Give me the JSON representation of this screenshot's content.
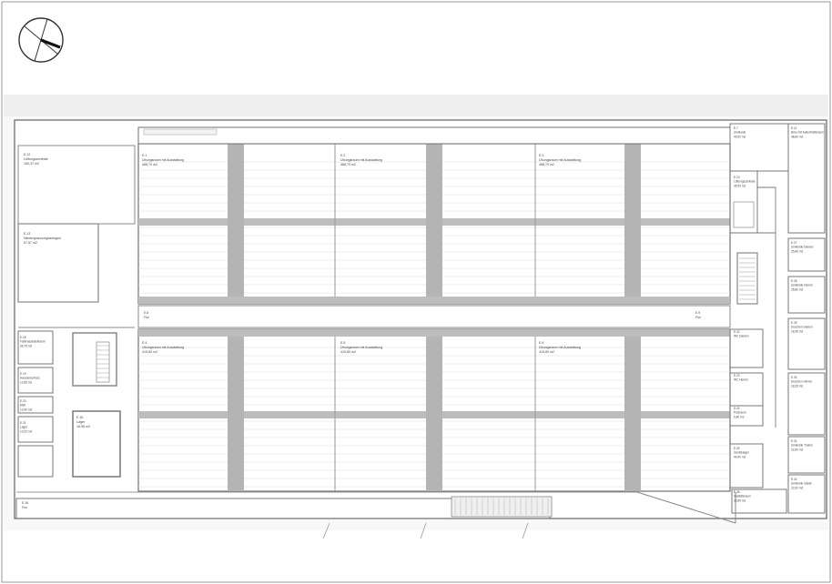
{
  "drawing": {
    "colors": {
      "line": "#6f6f6f",
      "column": "#b4b4b4",
      "beam": "#bdbdbd",
      "hatch": "#d9d9d9",
      "band": "#ededed",
      "text": "#555555"
    },
    "compass": {
      "icon": "north-arrow-icon"
    },
    "rooms": {
      "r1": {
        "id": "E.12",
        "name": "Lüftungszentrale",
        "area": "150,37 m2"
      },
      "r2": {
        "id": "E.13",
        "name": "Niederspannungsanlagen",
        "area": "57,57 m2"
      },
      "r3": {
        "id": "E.15",
        "name": "Lager",
        "area": "16,98 m2"
      },
      "rooms_left": [
        {
          "id": "E.18",
          "name": "Fahrradabstellraum",
          "area": "36,75 m2"
        },
        {
          "id": "E.19",
          "name": "Hausanschluss",
          "area": "12,85 m2"
        },
        {
          "id": "E.20",
          "name": "Müll",
          "area": "13,40 m2"
        },
        {
          "id": "E.21",
          "name": "Lager",
          "area": "10,20 m2"
        }
      ],
      "hall_top": [
        {
          "id": "E.1",
          "name": "Übungsraum mit Ausstattung",
          "area": "488,70 m2"
        },
        {
          "id": "E.2",
          "name": "Übungsraum mit Ausstattung",
          "area": "488,70 m2"
        },
        {
          "id": "E.3",
          "name": "Übungsraum mit Ausstattung",
          "area": "488,70 m2"
        }
      ],
      "hall_bottom": [
        {
          "id": "E.4",
          "name": "Übungsraum mit Ausstattung",
          "area": "415,80 m2"
        },
        {
          "id": "E.5",
          "name": "Übungsraum mit Ausstattung",
          "area": "415,80 m2"
        },
        {
          "id": "E.6",
          "name": "Übungsraum mit Ausstattung",
          "area": "415,80 m2"
        }
      ],
      "corridor_left": {
        "id": "E.8",
        "name": "Flur"
      },
      "corridor_right": {
        "id": "E.9",
        "name": "Flur"
      },
      "right_col": [
        {
          "id": "E.7",
          "name": "Umkleide",
          "area": "45,50 m2"
        },
        {
          "id": "E.10",
          "name": "Lüftungszentrale",
          "area": "35,50 m2"
        },
        {
          "id": "E.22",
          "name": "WC Damen",
          "area": ""
        },
        {
          "id": "E.23",
          "name": "WC Herren",
          "area": ""
        },
        {
          "id": "E.24",
          "name": "Putzraum",
          "area": "6,80 m2"
        },
        {
          "id": "E.25",
          "name": "Gerätelager",
          "area": "44,90 m2"
        },
        {
          "id": "E.26",
          "name": "Sanitätsraum",
          "area": "22,85 m2"
        }
      ],
      "far_right": [
        {
          "id": "E.11",
          "name": "Büro mit Aufenthaltsraum",
          "area": "48,80 m2"
        },
        {
          "id": "E.27",
          "name": "Umkleide Damen",
          "area": "25,80 m2"
        },
        {
          "id": "E.28",
          "name": "Umkleide Herren",
          "area": "25,80 m2"
        },
        {
          "id": "E.29",
          "name": "Duschen Damen",
          "area": "18,35 m2"
        },
        {
          "id": "E.30",
          "name": "Duschen Herren",
          "area": "18,35 m2"
        },
        {
          "id": "E.31",
          "name": "Umkleide Trainer",
          "area": "22,60 m2"
        },
        {
          "id": "E.32",
          "name": "Umkleide Gäste",
          "area": "22,60 m2"
        }
      ],
      "bottom_corridor": {
        "id": "E.16",
        "name": "Flur"
      }
    }
  }
}
